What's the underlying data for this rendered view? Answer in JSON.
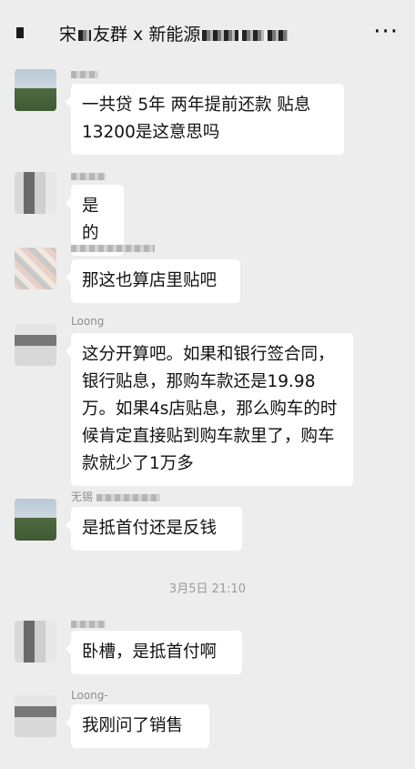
{
  "header": {
    "title_prefix": "宋",
    "title_main": "友群 x 新能源",
    "more_icon": "more-dots-icon",
    "back_icon": "back-icon"
  },
  "messages": [
    {
      "sender": "",
      "text": "一共贷 5年 两年提前还款 贴息 13200是这意思吗"
    },
    {
      "sender": "",
      "text": "是的"
    },
    {
      "sender": "",
      "text": "那这也算店里贴吧"
    },
    {
      "sender": "Loong",
      "text": "这分开算吧。如果和银行签合同，银行贴息，那购车款还是19.98万。如果4s店贴息，那么购车的时候肯定直接贴到购车款里了，购车款就少了1万多"
    },
    {
      "sender": "无锡",
      "text": "是抵首付还是反钱"
    },
    {
      "sender": "",
      "text": "卧槽，是抵首付啊"
    },
    {
      "sender": "Loong-",
      "text": "我刚问了销售"
    }
  ],
  "timestamp": "3月5日 21:10"
}
